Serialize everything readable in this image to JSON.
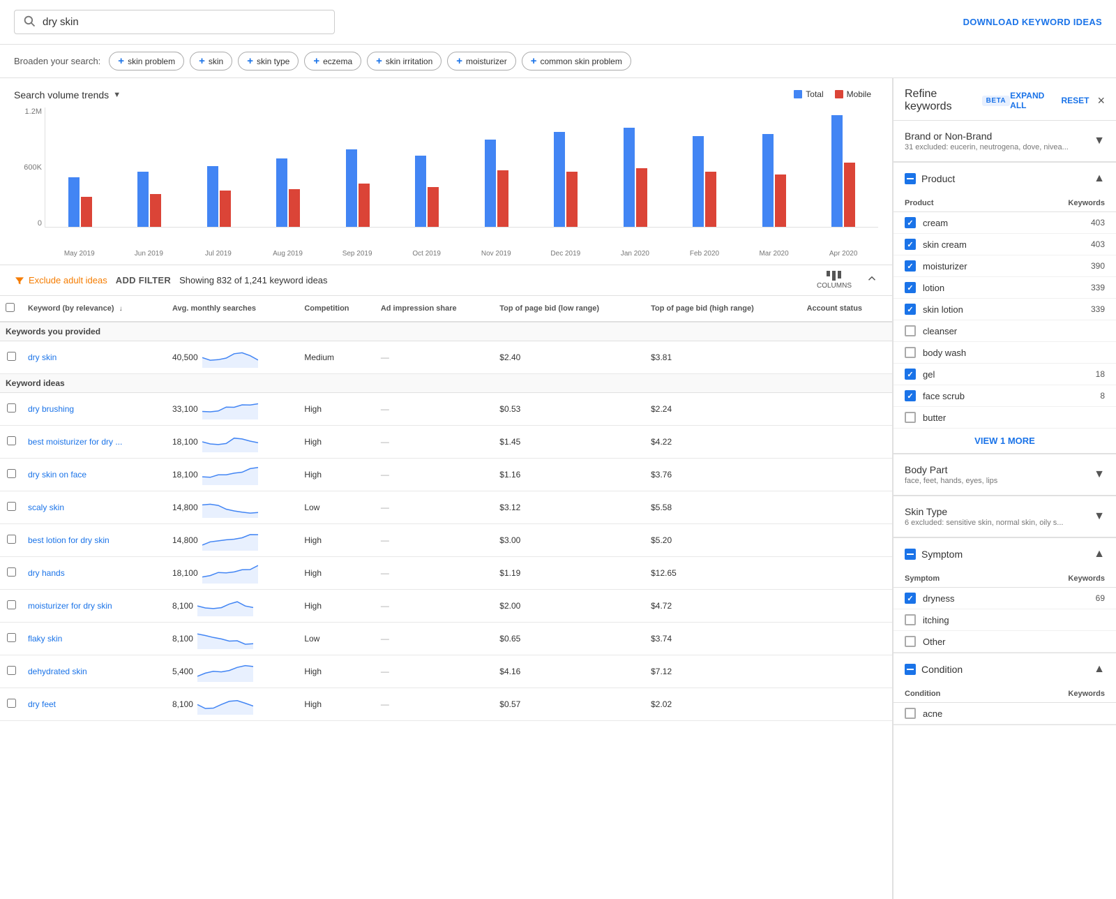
{
  "search": {
    "placeholder": "dry skin",
    "value": "dry skin"
  },
  "download_button": "DOWNLOAD KEYWORD IDEAS",
  "broaden": {
    "label": "Broaden your search:",
    "chips": [
      "skin problem",
      "skin",
      "skin type",
      "eczema",
      "skin irritation",
      "moisturizer",
      "common skin problem"
    ]
  },
  "chart": {
    "title": "Search volume trends",
    "legend": {
      "total": "Total",
      "mobile": "Mobile"
    },
    "y_labels": [
      "1.2M",
      "600K",
      "0"
    ],
    "bars": [
      {
        "month": "May 2019",
        "total": 52,
        "mobile": 32
      },
      {
        "month": "Jun 2019",
        "total": 58,
        "mobile": 35
      },
      {
        "month": "Jul 2019",
        "total": 64,
        "mobile": 38
      },
      {
        "month": "Aug 2019",
        "total": 72,
        "mobile": 40
      },
      {
        "month": "Sep 2019",
        "total": 82,
        "mobile": 46
      },
      {
        "month": "Oct 2019",
        "total": 75,
        "mobile": 42
      },
      {
        "month": "Nov 2019",
        "total": 92,
        "mobile": 60
      },
      {
        "month": "Dec 2019",
        "total": 100,
        "mobile": 58
      },
      {
        "month": "Jan 2020",
        "total": 105,
        "mobile": 62
      },
      {
        "month": "Feb 2020",
        "total": 96,
        "mobile": 58
      },
      {
        "month": "Mar 2020",
        "total": 98,
        "mobile": 55
      },
      {
        "month": "Apr 2020",
        "total": 118,
        "mobile": 68
      }
    ]
  },
  "toolbar": {
    "filter_label": "Exclude adult ideas",
    "add_filter": "ADD FILTER",
    "showing": "Showing 832 of 1,241 keyword ideas",
    "columns_label": "COLUMNS"
  },
  "table": {
    "headers": {
      "keyword": "Keyword (by relevance)",
      "avg_searches": "Avg. monthly searches",
      "competition": "Competition",
      "ad_impression": "Ad impression share",
      "top_low": "Top of page bid (low range)",
      "top_high": "Top of page bid (high range)",
      "account_status": "Account status"
    },
    "provided_label": "Keywords you provided",
    "ideas_label": "Keyword ideas",
    "provided_rows": [
      {
        "keyword": "dry skin",
        "avg": "40,500",
        "competition": "Medium",
        "ad_impression": "—",
        "bid_low": "$2.40",
        "bid_high": "$3.81",
        "account_status": ""
      }
    ],
    "idea_rows": [
      {
        "keyword": "dry brushing",
        "avg": "33,100",
        "competition": "High",
        "ad_impression": "—",
        "bid_low": "$0.53",
        "bid_high": "$2.24"
      },
      {
        "keyword": "best moisturizer for dry ...",
        "avg": "18,100",
        "competition": "High",
        "ad_impression": "—",
        "bid_low": "$1.45",
        "bid_high": "$4.22"
      },
      {
        "keyword": "dry skin on face",
        "avg": "18,100",
        "competition": "High",
        "ad_impression": "—",
        "bid_low": "$1.16",
        "bid_high": "$3.76"
      },
      {
        "keyword": "scaly skin",
        "avg": "14,800",
        "competition": "Low",
        "ad_impression": "—",
        "bid_low": "$3.12",
        "bid_high": "$5.58"
      },
      {
        "keyword": "best lotion for dry skin",
        "avg": "14,800",
        "competition": "High",
        "ad_impression": "—",
        "bid_low": "$3.00",
        "bid_high": "$5.20"
      },
      {
        "keyword": "dry hands",
        "avg": "18,100",
        "competition": "High",
        "ad_impression": "—",
        "bid_low": "$1.19",
        "bid_high": "$12.65"
      },
      {
        "keyword": "moisturizer for dry skin",
        "avg": "8,100",
        "competition": "High",
        "ad_impression": "—",
        "bid_low": "$2.00",
        "bid_high": "$4.72"
      },
      {
        "keyword": "flaky skin",
        "avg": "8,100",
        "competition": "Low",
        "ad_impression": "—",
        "bid_low": "$0.65",
        "bid_high": "$3.74"
      },
      {
        "keyword": "dehydrated skin",
        "avg": "5,400",
        "competition": "High",
        "ad_impression": "—",
        "bid_low": "$4.16",
        "bid_high": "$7.12"
      },
      {
        "keyword": "dry feet",
        "avg": "8,100",
        "competition": "High",
        "ad_impression": "—",
        "bid_low": "$0.57",
        "bid_high": "$2.02"
      }
    ]
  },
  "refine": {
    "title": "Refine keywords",
    "beta": "BETA",
    "expand_all": "EXPAND ALL",
    "reset": "RESET",
    "close_icon": "×",
    "sections": {
      "brand": {
        "title": "Brand or Non-Brand",
        "subtitle": "31 excluded: eucerin, neutrogena, dove, nivea...",
        "expanded": false
      },
      "product": {
        "title": "Product",
        "expanded": true,
        "col_keyword": "Product",
        "col_count": "Keywords",
        "items": [
          {
            "label": "cream",
            "count": "403",
            "checked": true
          },
          {
            "label": "skin cream",
            "count": "403",
            "checked": true
          },
          {
            "label": "moisturizer",
            "count": "390",
            "checked": true
          },
          {
            "label": "lotion",
            "count": "339",
            "checked": true
          },
          {
            "label": "skin lotion",
            "count": "339",
            "checked": true
          },
          {
            "label": "cleanser",
            "count": "",
            "checked": false
          },
          {
            "label": "body wash",
            "count": "",
            "checked": false
          },
          {
            "label": "gel",
            "count": "18",
            "checked": true
          },
          {
            "label": "face scrub",
            "count": "8",
            "checked": true
          },
          {
            "label": "butter",
            "count": "",
            "checked": false
          }
        ],
        "view_more": "VIEW 1 MORE"
      },
      "body_part": {
        "title": "Body Part",
        "subtitle": "face, feet, hands, eyes, lips",
        "expanded": false
      },
      "skin_type": {
        "title": "Skin Type",
        "subtitle": "6 excluded: sensitive skin, normal skin, oily s...",
        "expanded": false
      },
      "symptom": {
        "title": "Symptom",
        "expanded": true,
        "col_keyword": "Symptom",
        "col_count": "Keywords",
        "items": [
          {
            "label": "dryness",
            "count": "69",
            "checked": true
          },
          {
            "label": "itching",
            "count": "",
            "checked": false
          },
          {
            "label": "Other",
            "count": "",
            "checked": false
          }
        ]
      },
      "condition": {
        "title": "Condition",
        "expanded": true,
        "col_keyword": "Condition",
        "col_count": "Keywords",
        "items": [
          {
            "label": "acne",
            "count": "",
            "checked": false
          }
        ]
      }
    }
  }
}
